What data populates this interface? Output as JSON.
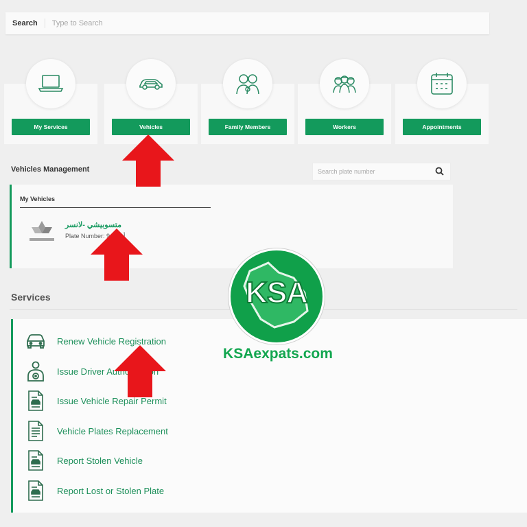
{
  "search": {
    "label": "Search",
    "placeholder": "Type to Search"
  },
  "cards": [
    {
      "label": "My Services",
      "icon": "laptop-icon"
    },
    {
      "label": "Vehicles",
      "icon": "car-icon"
    },
    {
      "label": "Family Members",
      "icon": "family-icon"
    },
    {
      "label": "Workers",
      "icon": "workers-icon"
    },
    {
      "label": "Appointments",
      "icon": "calendar-icon"
    }
  ],
  "vehicles_management": {
    "title": "Vehicles Management",
    "search_placeholder": "Search plate number",
    "my_vehicles_label": "My Vehicles",
    "vehicle": {
      "name": "متسوبيشي -لانسر",
      "plate_number": "Plate Number: 9 أ ب د"
    }
  },
  "services": {
    "title": "Services",
    "items": [
      {
        "label": "Renew Vehicle Registration",
        "icon": "car-front-icon"
      },
      {
        "label": "Issue Driver Authorization",
        "icon": "driver-icon"
      },
      {
        "label": "Issue Vehicle Repair Permit",
        "icon": "document-car-icon"
      },
      {
        "label": "Vehicle Plates Replacement",
        "icon": "document-icon"
      },
      {
        "label": "Report Stolen Vehicle",
        "icon": "document-car-icon"
      },
      {
        "label": "Report Lost or Stolen Plate",
        "icon": "document-car-icon"
      }
    ]
  },
  "watermark": {
    "logo_text": "KSA",
    "site": "KSAexpats.com"
  },
  "colors": {
    "accent": "#139a5c",
    "arrow": "#e8161b",
    "logo_green": "#10a04a"
  }
}
